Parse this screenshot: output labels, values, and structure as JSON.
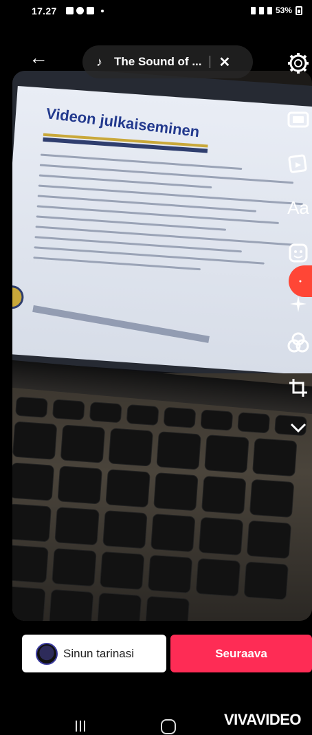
{
  "status": {
    "time": "17.27",
    "battery": "53%"
  },
  "header": {
    "sound_title": "The Sound of ..."
  },
  "preview": {
    "doc_title": "Videon julkaiseminen"
  },
  "sidebar": {
    "text_tool_label": "Aa"
  },
  "footer": {
    "story_label": "Sinun tarinasi",
    "next_label": "Seuraava"
  },
  "watermark": "VIVAVIDEO",
  "colors": {
    "accent": "#fe2c55",
    "background": "#000000",
    "record_bubble": "#ff4636"
  },
  "icons": [
    "back-arrow-icon",
    "music-note-icon",
    "close-icon",
    "gear-icon",
    "template-icon",
    "sticker-icon",
    "text-icon",
    "emoji-icon",
    "sparkle-icon",
    "filters-icon",
    "crop-icon",
    "chevron-down-icon"
  ]
}
